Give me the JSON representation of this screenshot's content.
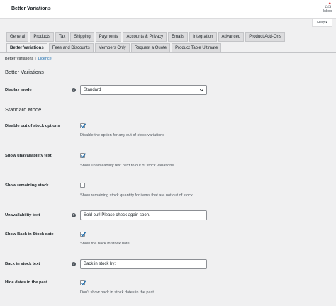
{
  "page": {
    "title": "Better Variations"
  },
  "activity": {
    "inbox_label": "Inbox",
    "help_label": "Help"
  },
  "tabs_primary": [
    {
      "label": "General"
    },
    {
      "label": "Products"
    },
    {
      "label": "Tax"
    },
    {
      "label": "Shipping"
    },
    {
      "label": "Payments"
    },
    {
      "label": "Accounts & Privacy"
    },
    {
      "label": "Emails"
    },
    {
      "label": "Integration"
    },
    {
      "label": "Advanced"
    },
    {
      "label": "Product Add-Ons"
    }
  ],
  "tabs_secondary": [
    {
      "label": "Better Variations",
      "active": true
    },
    {
      "label": "Fees and Discounts"
    },
    {
      "label": "Members Only"
    },
    {
      "label": "Request a Quote"
    },
    {
      "label": "Product Table Ultimate"
    }
  ],
  "subnav": {
    "current": "Better Variations",
    "separator": "|",
    "link": "Licence"
  },
  "section_main": {
    "title": "Better Variations"
  },
  "display_mode": {
    "label": "Display mode",
    "value": "Standard"
  },
  "section_standard": {
    "title": "Standard Mode"
  },
  "settings": {
    "disable_oos": {
      "label": "Disable out of stock options",
      "checked": true,
      "desc": "Disable the option for any out of stock variations"
    },
    "show_unavailability": {
      "label": "Show unavailability text",
      "checked": true,
      "desc": "Show unavailability text next to out of stock variations"
    },
    "show_remaining": {
      "label": "Show remaining stock",
      "checked": false,
      "desc": "Show remaining stock quantity for items that are not out of stock"
    },
    "unavailability_text": {
      "label": "Unavailability text",
      "value": "Sold out! Please check again soon."
    },
    "show_back_in_stock": {
      "label": "Show Back in Stock date",
      "checked": true,
      "desc": "Show the back in stock date"
    },
    "back_in_stock_text": {
      "label": "Back in stock text",
      "value": "Back in stock by:"
    },
    "hide_past_dates": {
      "label": "Hide dates in the past",
      "checked": true,
      "desc": "Don't show back in stock dates in the past"
    }
  },
  "icons": {
    "tooltip": "help-tooltip-icon",
    "checkmark": "checkmark-icon",
    "dropdown": "chevron-down-icon",
    "inbox": "inbox-icon"
  },
  "colors": {
    "accent": "#2271b1",
    "background": "#f0f0f1",
    "tab": "#dcdcde"
  }
}
